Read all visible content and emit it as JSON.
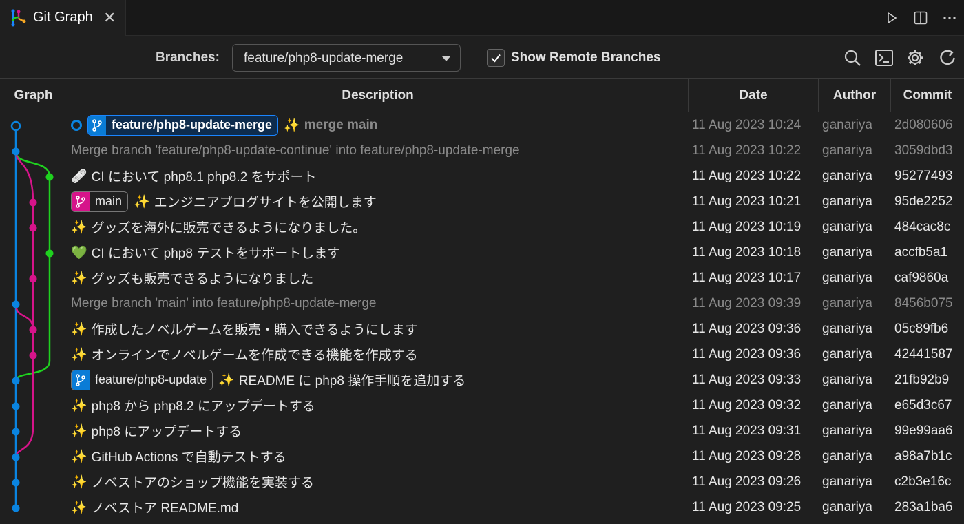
{
  "tab": {
    "title": "Git Graph",
    "close": "✕"
  },
  "tab_actions": [
    "run-icon",
    "split-editor-icon",
    "more-actions-icon"
  ],
  "controls": {
    "branches_label": "Branches:",
    "branch_value": "feature/php8-update-merge",
    "show_remote_label": "Show Remote Branches",
    "show_remote_checked": true,
    "icons": [
      "search-icon",
      "terminal-icon",
      "gear-icon",
      "refresh-icon"
    ]
  },
  "columns": {
    "graph": "Graph",
    "description": "Description",
    "date": "Date",
    "author": "Author",
    "commit": "Commit"
  },
  "colors": {
    "blue": "#0a84e0",
    "pink": "#d6148a",
    "green": "#1fd11f"
  },
  "commits": [
    {
      "head_marker": true,
      "ref": {
        "name": "feature/php8-update-merge",
        "color": "blue",
        "head": true
      },
      "emoji": "✨",
      "message": "merge main",
      "date": "11 Aug 2023 10:24",
      "author": "ganariya",
      "hash": "2d080606",
      "dim": true
    },
    {
      "message": "Merge branch 'feature/php8-update-continue' into feature/php8-update-merge",
      "date": "11 Aug 2023 10:22",
      "author": "ganariya",
      "hash": "3059dbd3",
      "dim": true
    },
    {
      "emoji": "🩹",
      "message": "CI において php8.1 php8.2 をサポート",
      "date": "11 Aug 2023 10:22",
      "author": "ganariya",
      "hash": "95277493"
    },
    {
      "ref": {
        "name": "main",
        "color": "pink"
      },
      "emoji": "✨",
      "message": "エンジニアブログサイトを公開します",
      "date": "11 Aug 2023 10:21",
      "author": "ganariya",
      "hash": "95de2252"
    },
    {
      "emoji": "✨",
      "message": "グッズを海外に販売できるようになりました。",
      "date": "11 Aug 2023 10:19",
      "author": "ganariya",
      "hash": "484cac8c"
    },
    {
      "emoji": "💚",
      "message": "CI において php8 テストをサポートします",
      "date": "11 Aug 2023 10:18",
      "author": "ganariya",
      "hash": "accfb5a1"
    },
    {
      "emoji": "✨",
      "message": "グッズも販売できるようになりました",
      "date": "11 Aug 2023 10:17",
      "author": "ganariya",
      "hash": "caf9860a"
    },
    {
      "message": "Merge branch 'main' into feature/php8-update-merge",
      "date": "11 Aug 2023 09:39",
      "author": "ganariya",
      "hash": "8456b075",
      "dim": true
    },
    {
      "emoji": "✨",
      "message": "作成したノベルゲームを販売・購入できるようにします",
      "date": "11 Aug 2023 09:36",
      "author": "ganariya",
      "hash": "05c89fb6"
    },
    {
      "emoji": "✨",
      "message": "オンラインでノベルゲームを作成できる機能を作成する",
      "date": "11 Aug 2023 09:36",
      "author": "ganariya",
      "hash": "42441587"
    },
    {
      "ref": {
        "name": "feature/php8-update",
        "color": "blue"
      },
      "emoji": "✨",
      "message": "README に php8 操作手順を追加する",
      "date": "11 Aug 2023 09:33",
      "author": "ganariya",
      "hash": "21fb92b9"
    },
    {
      "emoji": "✨",
      "message": "php8 から php8.2 にアップデートする",
      "date": "11 Aug 2023 09:32",
      "author": "ganariya",
      "hash": "e65d3c67"
    },
    {
      "emoji": "✨",
      "message": "php8 にアップデートする",
      "date": "11 Aug 2023 09:31",
      "author": "ganariya",
      "hash": "99e99aa6"
    },
    {
      "emoji": "✨",
      "message": "GitHub Actions で自動テストする",
      "date": "11 Aug 2023 09:28",
      "author": "ganariya",
      "hash": "a98a7b1c"
    },
    {
      "emoji": "✨",
      "message": "ノベストアのショップ機能を実装する",
      "date": "11 Aug 2023 09:26",
      "author": "ganariya",
      "hash": "c2b3e16c"
    },
    {
      "emoji": "✨",
      "message": "ノベストア README.md",
      "date": "11 Aug 2023 09:25",
      "author": "ganariya",
      "hash": "283a1ba6"
    }
  ]
}
